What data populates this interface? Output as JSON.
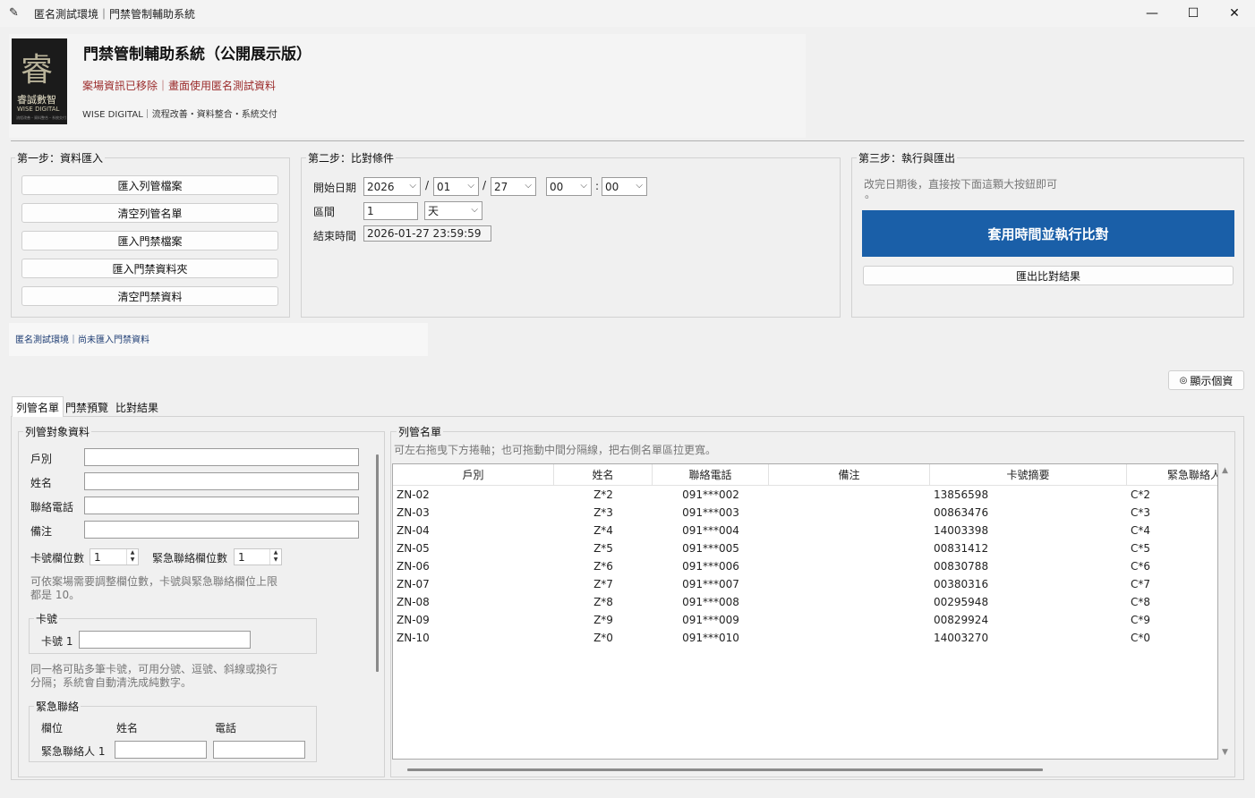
{
  "window": {
    "title": "匿名測試環境｜門禁管制輔助系統",
    "minimize_glyph": "—",
    "maximize_glyph": "☐",
    "close_glyph": "✕",
    "app_icon_glyph": "✎"
  },
  "header": {
    "logo_mark": "睿",
    "logo_cn": "睿誠數智",
    "logo_en": "WISE DIGITAL",
    "logo_tiny": "流程改善・資料整合・系統交付",
    "title": "門禁管制輔助系統（公開展示版）",
    "warning": "案場資訊已移除｜畫面使用匿名測試資料",
    "tagline": "WISE DIGITAL｜流程改善・資料整合・系統交付"
  },
  "step1": {
    "label": "第一步：資料匯入",
    "buttons": [
      "匯入列管檔案",
      "清空列管名單",
      "匯入門禁檔案",
      "匯入門禁資料夾",
      "清空門禁資料"
    ]
  },
  "step2": {
    "label": "第二步：比對條件",
    "start_label": "開始日期",
    "year": "2026",
    "month": "01",
    "day": "27",
    "hour": "00",
    "minute": "00",
    "date_sep": "/",
    "time_sep": ":",
    "interval_label": "區間",
    "interval_value": "1",
    "interval_unit": "天",
    "end_label": "結束時間",
    "end_value": "2026-01-27 23:59:59"
  },
  "step3": {
    "label": "第三步：執行與匯出",
    "hint": "改完日期後，直接按下面這顆大按鈕即可",
    "hint_dot": "。",
    "run_button": "套用時間並執行比對",
    "export_button": "匯出比對結果"
  },
  "status": {
    "text": "匿名測試環境｜尚未匯入門禁資料"
  },
  "privacy_button": "顯示個資",
  "privacy_icon": "◎",
  "tabs": [
    "列管名單",
    "門禁預覽",
    "比對結果"
  ],
  "form": {
    "group_label": "列管對象資料",
    "fields": [
      "戶別",
      "姓名",
      "聯絡電話",
      "備注"
    ],
    "card_count_label": "卡號欄位數",
    "card_count_value": "1",
    "emergency_count_label": "緊急聯絡欄位數",
    "emergency_count_value": "1",
    "limit_hint_1": "可依案場需要調整欄位數，卡號與緊急聯絡欄位上限",
    "limit_hint_2": "都是 10。",
    "card_group_label": "卡號",
    "card_field_label": "卡號 1",
    "paste_hint_1": "同一格可貼多筆卡號，可用分號、逗號、斜線或換行",
    "paste_hint_2": "分隔；系統會自動清洗成純數字。",
    "emergency_group_label": "緊急聯絡",
    "emergency_headers": [
      "欄位",
      "姓名",
      "電話"
    ],
    "emergency_row_label": "緊急聯絡人 1"
  },
  "list": {
    "group_label": "列管名單",
    "hint": "可左右拖曳下方捲軸；也可拖動中間分隔線，把右側名單區拉更寬。",
    "columns": [
      "戶別",
      "姓名",
      "聯絡電話",
      "備注",
      "卡號摘要",
      "緊急聯絡人"
    ],
    "rows": [
      [
        "ZN-02",
        "Z*2",
        "091***002",
        "",
        "13856598",
        "C*2"
      ],
      [
        "ZN-03",
        "Z*3",
        "091***003",
        "",
        "00863476",
        "C*3"
      ],
      [
        "ZN-04",
        "Z*4",
        "091***004",
        "",
        "14003398",
        "C*4"
      ],
      [
        "ZN-05",
        "Z*5",
        "091***005",
        "",
        "00831412",
        "C*5"
      ],
      [
        "ZN-06",
        "Z*6",
        "091***006",
        "",
        "00830788",
        "C*6"
      ],
      [
        "ZN-07",
        "Z*7",
        "091***007",
        "",
        "00380316",
        "C*7"
      ],
      [
        "ZN-08",
        "Z*8",
        "091***008",
        "",
        "00295948",
        "C*8"
      ],
      [
        "ZN-09",
        "Z*9",
        "091***009",
        "",
        "00829924",
        "C*9"
      ],
      [
        "ZN-10",
        "Z*0",
        "091***010",
        "",
        "14003270",
        "C*0"
      ]
    ]
  },
  "colors": {
    "accent": "#1a5fa8",
    "warning": "#9b2b2b",
    "status": "#1f3e74"
  }
}
